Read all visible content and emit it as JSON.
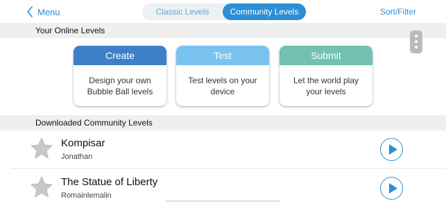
{
  "nav": {
    "back_label": "Menu",
    "back_icon": "chevron-left-icon",
    "tabs": [
      {
        "label": "Classic Levels",
        "selected": false
      },
      {
        "label": "Community Levels",
        "selected": true
      }
    ],
    "sort_filter_label": "Sort/Filter"
  },
  "online_section": {
    "header": "Your Online Levels",
    "more_icon": "kebab-menu-icon",
    "cards": [
      {
        "title": "Create",
        "description": "Design your own Bubble Ball levels",
        "color": "#3d80c9"
      },
      {
        "title": "Test",
        "description": "Test levels on your device",
        "color": "#79c2ef"
      },
      {
        "title": "Submit",
        "description": "Let the world play your levels",
        "color": "#72c1b3"
      }
    ]
  },
  "downloaded_section": {
    "header": "Downloaded Community Levels",
    "levels": [
      {
        "title": "Kompisar",
        "author": "Jonathan",
        "star_icon": "star-icon",
        "action_icon": "play-icon"
      },
      {
        "title": "The Statue of Liberty",
        "author": "Romainlemalin",
        "star_icon": "star-icon",
        "action_icon": "play-icon"
      }
    ]
  },
  "colors": {
    "accent": "#2a8fd6",
    "section_header_bg": "#efefef",
    "star": "#c8c8c8"
  }
}
